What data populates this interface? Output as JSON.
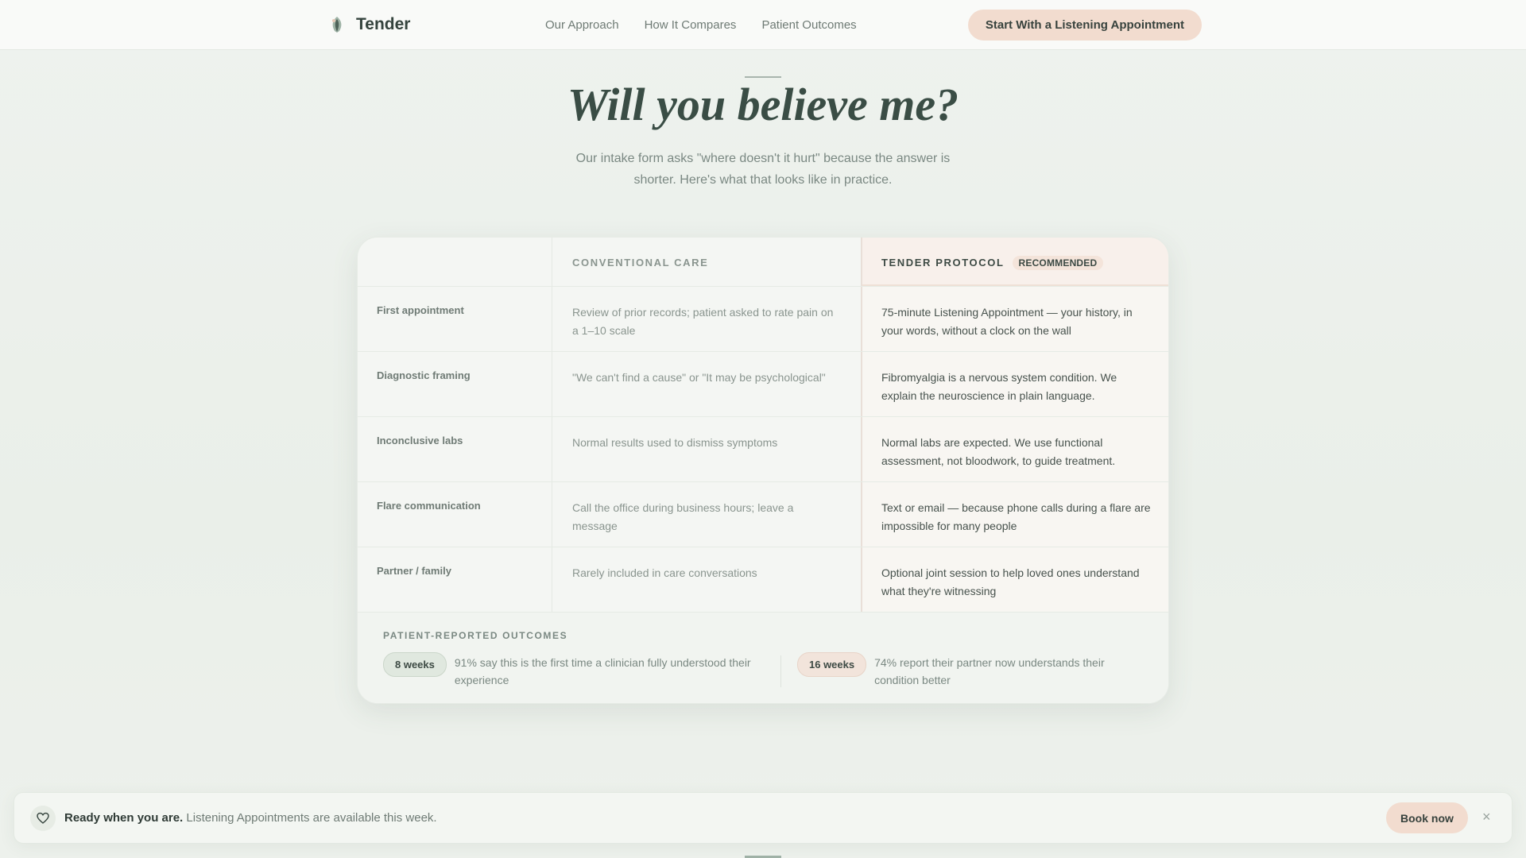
{
  "nav": {
    "brand": "Tender",
    "links": [
      "Our Approach",
      "How It Compares",
      "Patient Outcomes"
    ],
    "cta": "Start With a Listening Appointment"
  },
  "hero": {
    "title": "Will you believe me?",
    "subtitle": "Our intake form asks \"where doesn't it hurt\" because the answer is shorter. Here's what that looks like in practice."
  },
  "comparison": {
    "col_conventional": "CONVENTIONAL CARE",
    "col_tender": "TENDER PROTOCOL",
    "recommended_badge": "RECOMMENDED",
    "rows": [
      {
        "label": "First appointment",
        "conventional": "Review of prior records; patient asked to rate pain on a 1–10 scale",
        "tender": "75-minute Listening Appointment — your history, in your words, without a clock on the wall"
      },
      {
        "label": "Diagnostic framing",
        "conventional": "\"We can't find a cause\" or \"It may be psychological\"",
        "tender": "Fibromyalgia is a nervous system condition. We explain the neuroscience in plain language."
      },
      {
        "label": "Inconclusive labs",
        "conventional": "Normal results used to dismiss symptoms",
        "tender": "Normal labs are expected. We use functional assessment, not bloodwork, to guide treatment."
      },
      {
        "label": "Flare communication",
        "conventional": "Call the office during business hours; leave a message",
        "tender": "Text or email — because phone calls during a flare are impossible for many people"
      },
      {
        "label": "Partner / family",
        "conventional": "Rarely included in care conversations",
        "tender": "Optional joint session to help loved ones understand what they're witnessing"
      }
    ],
    "outcomes": {
      "label": "PATIENT-REPORTED OUTCOMES",
      "items": [
        {
          "badge": "8 weeks",
          "text": "91% say this is the first time a clinician fully understood their experience"
        },
        {
          "badge": "16 weeks",
          "text": "74% report their partner now understands their condition better"
        }
      ]
    }
  },
  "banner": {
    "bold": "Ready when you are.",
    "text": "Listening Appointments are available this week.",
    "button": "Book now",
    "close": "×"
  },
  "colors": {
    "accent_peach": "#f2dccf",
    "brand_green": "#3a4d45",
    "background": "#edf1ec"
  }
}
